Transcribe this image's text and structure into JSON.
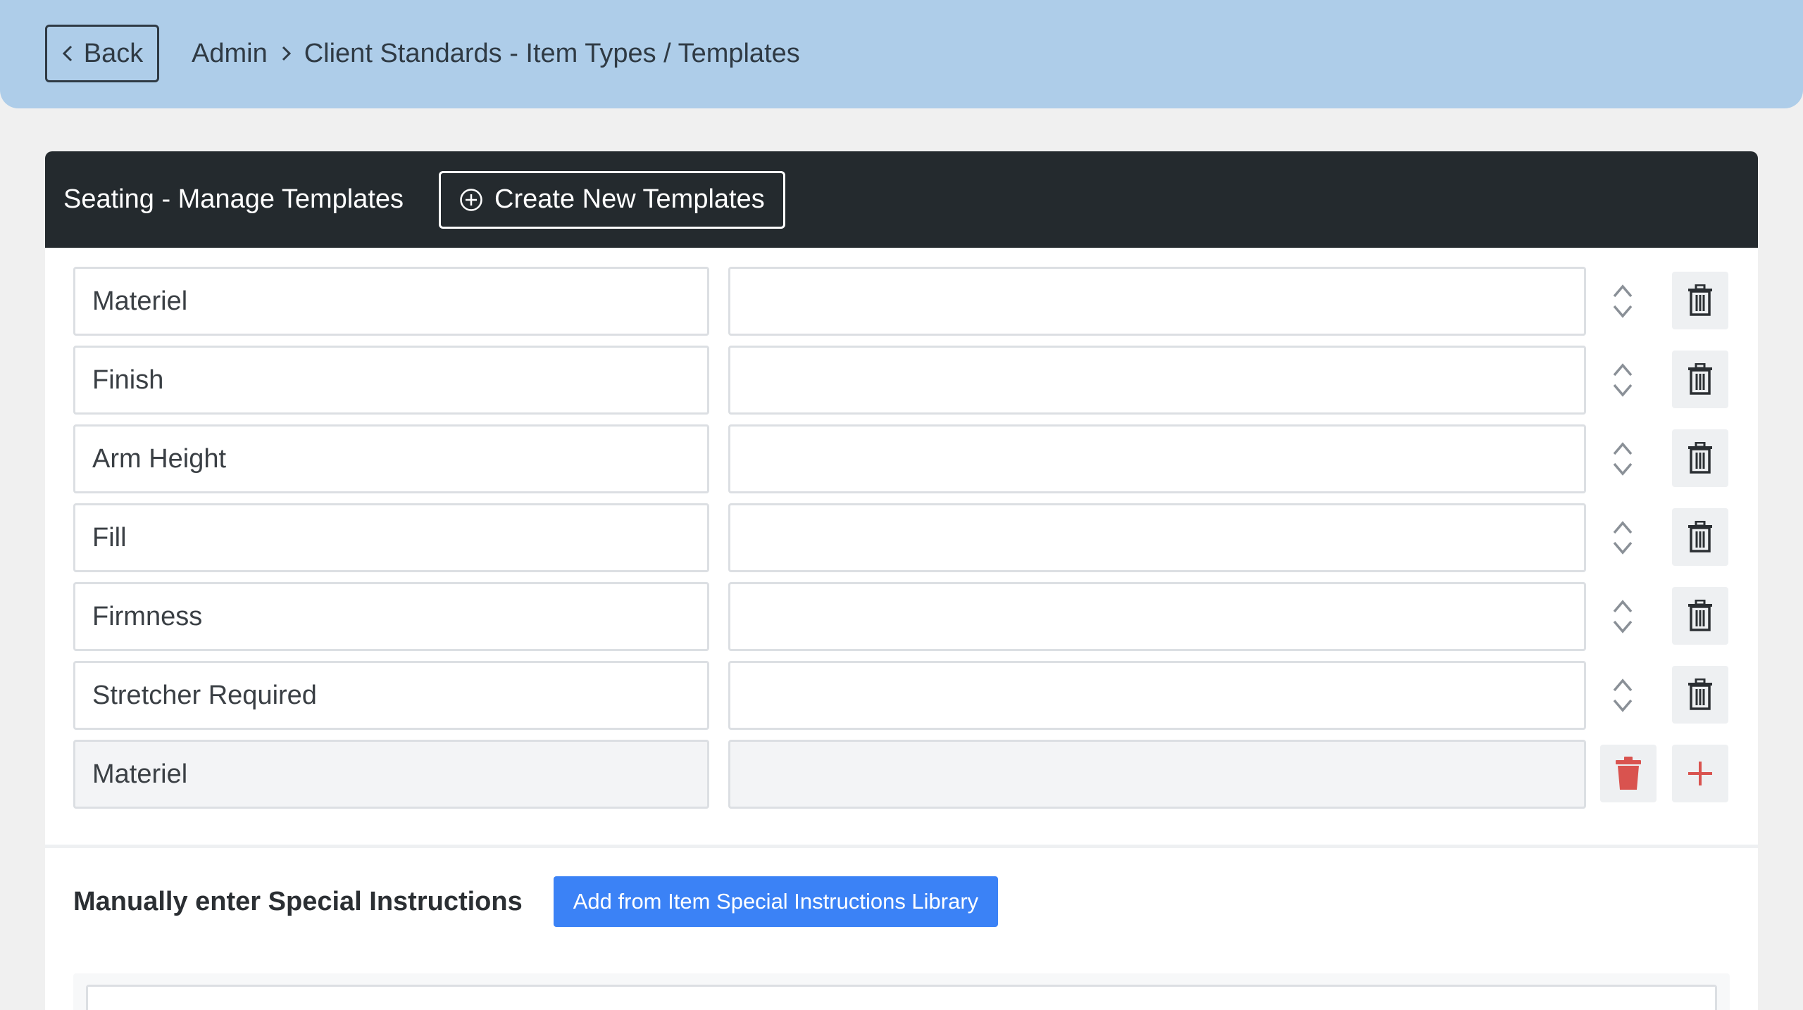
{
  "topbar": {
    "back_label": "Back",
    "breadcrumb": [
      "Admin",
      "Client Standards - Item Types / Templates"
    ]
  },
  "card": {
    "title": "Seating - Manage Templates",
    "create_label": "Create New Templates"
  },
  "rows": [
    {
      "name": "Materiel",
      "value": ""
    },
    {
      "name": "Finish",
      "value": ""
    },
    {
      "name": "Arm Height",
      "value": ""
    },
    {
      "name": "Fill",
      "value": ""
    },
    {
      "name": "Firmness",
      "value": ""
    },
    {
      "name": "Stretcher Required",
      "value": ""
    }
  ],
  "new_row": {
    "name": "Materiel",
    "value": ""
  },
  "special": {
    "title": "Manually enter Special Instructions",
    "library_label": "Add from Item Special Instructions Library"
  },
  "colors": {
    "topbar": "#aecde9",
    "header": "#242a2e",
    "accent": "#3b82f6",
    "danger": "#d9534f"
  }
}
